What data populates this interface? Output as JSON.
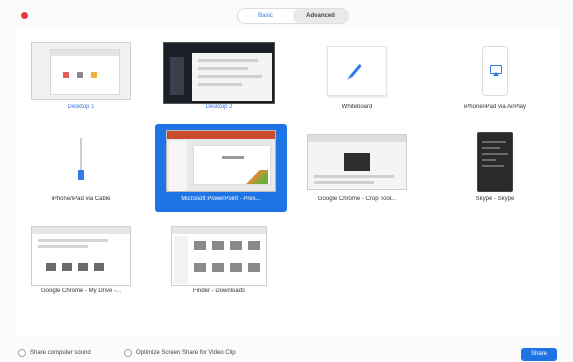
{
  "tabs": [
    {
      "label": "Basic",
      "active": false
    },
    {
      "label": "Advanced",
      "active": true
    }
  ],
  "sources": [
    {
      "label": "Desktop 1",
      "label_color": "blue"
    },
    {
      "label": "Desktop 2",
      "label_color": "blue"
    },
    {
      "label": "Whiteboard"
    },
    {
      "label": "iPhone/iPad via AirPlay"
    },
    {
      "label": "iPhone/iPad via Cable"
    },
    {
      "label": "Microsoft PowerPoint - Pres...",
      "selected": true
    },
    {
      "label": "Google Chrome - Crop Tool..."
    },
    {
      "label": "Skype - Skype"
    },
    {
      "label": "Google Chrome - My Drive -..."
    },
    {
      "label": "Finder - Downloads"
    }
  ],
  "footer": {
    "share_sound_label": "Share computer sound",
    "optimize_label": "Optimize Screen Share for Video Clip",
    "share_button_label": "Share"
  },
  "colors": {
    "accent": "#1f74e5",
    "close_button": "#ea3b3b"
  }
}
